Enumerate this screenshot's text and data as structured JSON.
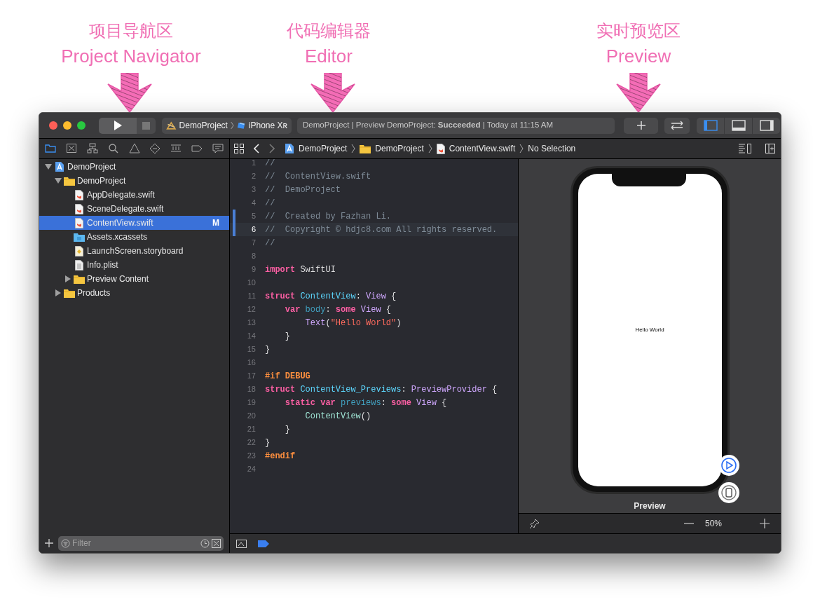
{
  "annotations": [
    {
      "title": "项目导航区",
      "subtitle": "Project Navigator"
    },
    {
      "title": "代码编辑器",
      "subtitle": "Editor"
    },
    {
      "title": "实时预览区",
      "subtitle": "Preview"
    }
  ],
  "toolbar": {
    "scheme": {
      "project": "DemoProject",
      "device": "iPhone Xʀ"
    },
    "status": "DemoProject | Preview DemoProject: **Succeeded** | Today at 11:15 AM",
    "panel_toggles": [
      {
        "kind": "left",
        "selected": true
      },
      {
        "kind": "bottom",
        "selected": false
      },
      {
        "kind": "right",
        "selected": false
      }
    ]
  },
  "navigator": {
    "tabs": [
      {
        "kind": "folder",
        "selected": true
      },
      {
        "kind": "source-control",
        "selected": false
      },
      {
        "kind": "hierarchy",
        "selected": false
      },
      {
        "kind": "search",
        "selected": false
      },
      {
        "kind": "warning",
        "selected": false
      },
      {
        "kind": "test",
        "selected": false
      },
      {
        "kind": "debug",
        "selected": false
      },
      {
        "kind": "breakpoint",
        "selected": false
      },
      {
        "kind": "report",
        "selected": false
      }
    ],
    "tree": [
      {
        "name": "DemoProject",
        "kind": "project",
        "expanded": true,
        "selected": false,
        "children": [
          {
            "name": "DemoProject",
            "kind": "folder",
            "expanded": true,
            "selected": false,
            "children": [
              {
                "name": "AppDelegate.swift",
                "kind": "swift",
                "selected": false
              },
              {
                "name": "SceneDelegate.swift",
                "kind": "swift",
                "selected": false
              },
              {
                "name": "ContentView.swift",
                "kind": "swift",
                "selected": true,
                "badge": "M"
              },
              {
                "name": "Assets.xcassets",
                "kind": "assets",
                "selected": false
              },
              {
                "name": "LaunchScreen.storyboard",
                "kind": "storyboard",
                "selected": false
              },
              {
                "name": "Info.plist",
                "kind": "plist",
                "selected": false
              },
              {
                "name": "Preview Content",
                "kind": "folder",
                "expanded": false,
                "selected": false
              }
            ]
          },
          {
            "name": "Products",
            "kind": "folder",
            "expanded": false,
            "selected": false
          }
        ]
      }
    ],
    "filter": {
      "placeholder": "Filter"
    }
  },
  "jump_bar": {
    "path": [
      {
        "kind": "project",
        "label": "DemoProject"
      },
      {
        "kind": "folder",
        "label": "DemoProject"
      },
      {
        "kind": "swift",
        "label": "ContentView.swift"
      },
      {
        "kind": "none",
        "label": "No Selection"
      }
    ]
  },
  "editor": {
    "lines": [
      {
        "number": "1",
        "current": false,
        "changed": false,
        "tokens": [
          {
            "kind": "comment",
            "text": "//"
          }
        ]
      },
      {
        "number": "2",
        "current": false,
        "changed": false,
        "tokens": [
          {
            "kind": "comment",
            "text": "//  ContentView.swift"
          }
        ]
      },
      {
        "number": "3",
        "current": false,
        "changed": false,
        "tokens": [
          {
            "kind": "comment",
            "text": "//  DemoProject"
          }
        ]
      },
      {
        "number": "4",
        "current": false,
        "changed": false,
        "tokens": [
          {
            "kind": "comment",
            "text": "//"
          }
        ]
      },
      {
        "number": "5",
        "current": false,
        "changed": true,
        "tokens": [
          {
            "kind": "comment",
            "text": "//  Created by Fazhan Li."
          }
        ]
      },
      {
        "number": "6",
        "current": true,
        "changed": true,
        "tokens": [
          {
            "kind": "comment",
            "text": "//  Copyright © hdjc8.com All rights reserved."
          }
        ]
      },
      {
        "number": "7",
        "current": false,
        "changed": false,
        "tokens": [
          {
            "kind": "comment",
            "text": "//"
          }
        ]
      },
      {
        "number": "8",
        "current": false,
        "changed": false
      },
      {
        "number": "9",
        "current": false,
        "changed": false,
        "tokens": [
          {
            "kind": "keyword",
            "text": "import"
          },
          {
            "kind": "plain",
            "text": " SwiftUI"
          }
        ]
      },
      {
        "number": "10",
        "current": false,
        "changed": false
      },
      {
        "number": "11",
        "current": false,
        "changed": false,
        "tokens": [
          {
            "kind": "keyword",
            "text": "struct"
          },
          {
            "kind": "decl",
            "text": " ContentView"
          },
          {
            "kind": "plain",
            "text": ": "
          },
          {
            "kind": "type",
            "text": "View"
          },
          {
            "kind": "plain",
            "text": " {"
          }
        ]
      },
      {
        "number": "12",
        "current": false,
        "changed": false,
        "tokens": [
          {
            "kind": "keyword",
            "text": "    var"
          },
          {
            "kind": "property",
            "text": " body"
          },
          {
            "kind": "plain",
            "text": ": "
          },
          {
            "kind": "keyword",
            "text": "some"
          },
          {
            "kind": "type",
            "text": " View"
          },
          {
            "kind": "plain",
            "text": " {"
          }
        ]
      },
      {
        "number": "13",
        "current": false,
        "changed": false,
        "tokens": [
          {
            "kind": "type",
            "text": "        Text"
          },
          {
            "kind": "plain",
            "text": "("
          },
          {
            "kind": "string",
            "text": "\"Hello World\""
          },
          {
            "kind": "plain",
            "text": ")"
          }
        ]
      },
      {
        "number": "14",
        "current": false,
        "changed": false,
        "tokens": [
          {
            "kind": "plain",
            "text": "    }"
          }
        ]
      },
      {
        "number": "15",
        "current": false,
        "changed": false,
        "tokens": [
          {
            "kind": "plain",
            "text": "}"
          }
        ]
      },
      {
        "number": "16",
        "current": false,
        "changed": false
      },
      {
        "number": "17",
        "current": false,
        "changed": false,
        "tokens": [
          {
            "kind": "preproc",
            "text": "#if DEBUG"
          }
        ]
      },
      {
        "number": "18",
        "current": false,
        "changed": false,
        "tokens": [
          {
            "kind": "keyword",
            "text": "struct"
          },
          {
            "kind": "decl",
            "text": " ContentView_Previews"
          },
          {
            "kind": "plain",
            "text": ": "
          },
          {
            "kind": "type",
            "text": "PreviewProvider"
          },
          {
            "kind": "plain",
            "text": " {"
          }
        ]
      },
      {
        "number": "19",
        "current": false,
        "changed": false,
        "tokens": [
          {
            "kind": "keyword",
            "text": "    static var"
          },
          {
            "kind": "property",
            "text": " previews"
          },
          {
            "kind": "plain",
            "text": ": "
          },
          {
            "kind": "keyword",
            "text": "some"
          },
          {
            "kind": "type",
            "text": " View"
          },
          {
            "kind": "plain",
            "text": " {"
          }
        ]
      },
      {
        "number": "20",
        "current": false,
        "changed": false,
        "tokens": [
          {
            "kind": "call",
            "text": "        ContentView"
          },
          {
            "kind": "plain",
            "text": "()"
          }
        ]
      },
      {
        "number": "21",
        "current": false,
        "changed": false,
        "tokens": [
          {
            "kind": "plain",
            "text": "    }"
          }
        ]
      },
      {
        "number": "22",
        "current": false,
        "changed": false,
        "tokens": [
          {
            "kind": "plain",
            "text": "}"
          }
        ]
      },
      {
        "number": "23",
        "current": false,
        "changed": false,
        "tokens": [
          {
            "kind": "preproc",
            "text": "#endif"
          }
        ]
      },
      {
        "number": "24",
        "current": false,
        "changed": false
      }
    ]
  },
  "preview": {
    "screen_text": "Hello World",
    "label": "Preview",
    "zoom": "50%"
  }
}
